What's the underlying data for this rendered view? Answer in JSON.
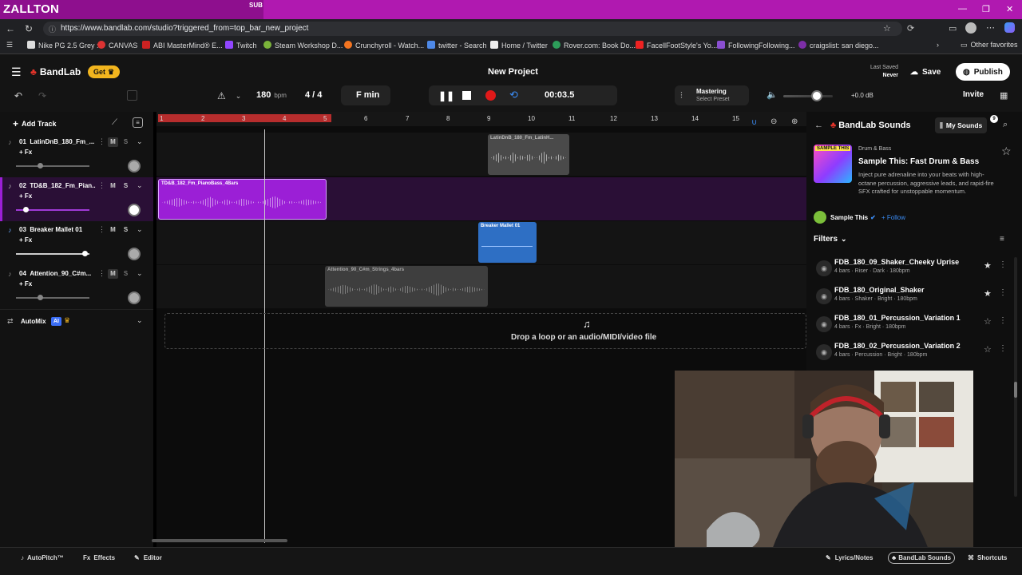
{
  "stream": {
    "name": "ZALLTON",
    "sub": "SUB"
  },
  "browser": {
    "url": "https://www.bandlab.com/studio?triggered_from=top_bar_new_project",
    "bookmarks": [
      "Nike PG 2.5 Grey :",
      "CANVAS",
      "ABI MasterMind® E...",
      "Twitch",
      "Steam Workshop D...",
      "Crunchyroll - Watch...",
      "twitter - Search",
      "Home / Twitter",
      "Rover.com: Book Do...",
      "FacellFootStyle's Yo...",
      "FollowingFollowing...",
      "craigslist: san diego..."
    ],
    "other_favorites": "Other favorites"
  },
  "header": {
    "brand": "BandLab",
    "get_label": "Get",
    "project_title": "New Project",
    "last_saved_label": "Last Saved",
    "last_saved_value": "Never",
    "save_label": "Save",
    "publish_label": "Publish",
    "invite_label": "Invite"
  },
  "transport": {
    "bpm": "180",
    "bpm_unit": "bpm",
    "time_sig": "4 / 4",
    "key": "F min",
    "time": "00:03.5",
    "mastering_label": "Mastering",
    "mastering_sub": "Select Preset",
    "volume_db": "+0.0 dB"
  },
  "tracks_panel": {
    "add_track": "Add Track",
    "automix": "AutoMix",
    "ai_badge": "AI",
    "tracks": [
      {
        "num": "01",
        "name": "LatinDnB_180_Fm_...",
        "fx": "+ Fx"
      },
      {
        "num": "02",
        "name": "TD&B_182_Fm_Pian...",
        "fx": "+ Fx"
      },
      {
        "num": "03",
        "name": "Breaker Mallet 01",
        "fx": "+ Fx"
      },
      {
        "num": "04",
        "name": "Attention_90_C#m...",
        "fx": "+ Fx"
      }
    ],
    "m": "M",
    "s": "S"
  },
  "ruler": [
    "1",
    "2",
    "3",
    "4",
    "5",
    "6",
    "7",
    "8",
    "9",
    "10",
    "11",
    "12",
    "13",
    "14",
    "15"
  ],
  "clips": [
    {
      "label": "LatinDnB_180_Fm_LatinH..."
    },
    {
      "label": "TD&B_182_Fm_PianoBass_4Bars"
    },
    {
      "label": "Breaker Mallet 01"
    },
    {
      "label": "Attention_90_C#m_Strings_4bars"
    }
  ],
  "drop_text": "Drop a loop or an audio/MIDI/video file",
  "sounds": {
    "brand": "BandLab Sounds",
    "my_sounds": "My Sounds",
    "badge_count": "9",
    "pack_thumb_label": "SAMPLE THIS",
    "genre": "Drum & Bass",
    "pack_title": "Sample This: Fast Drum & Bass",
    "pack_desc": "Inject pure adrenaline into your beats with high-octane percussion, aggressive leads, and rapid-fire SFX crafted for unstoppable momentum.",
    "creator": "Sample This",
    "follow": "Follow",
    "filters": "Filters",
    "items": [
      {
        "name": "FDB_180_09_Shaker_Cheeky Uprise",
        "info": "4 bars · Riser · Dark · 180bpm"
      },
      {
        "name": "FDB_180_Original_Shaker",
        "info": "4 bars · Shaker · Bright · 180bpm"
      },
      {
        "name": "FDB_180_01_Percussion_Variation 1",
        "info": "4 bars · Fx · Bright · 180bpm"
      },
      {
        "name": "FDB_180_02_Percussion_Variation 2",
        "info": "4 bars · Percussion · Bright · 180bpm"
      }
    ]
  },
  "bottom": {
    "autopitch": "AutoPitch™",
    "effects": "Effects",
    "editor": "Editor",
    "lyrics": "Lyrics/Notes",
    "bandlab_sounds": "BandLab Sounds",
    "shortcuts": "Shortcuts"
  },
  "colors": {
    "accent_purple": "#9b1fd6",
    "record_red": "#e01919",
    "loop_red": "#b72d2d",
    "clip_blue": "#2e6fc4",
    "get_yellow": "#f2b51e"
  }
}
